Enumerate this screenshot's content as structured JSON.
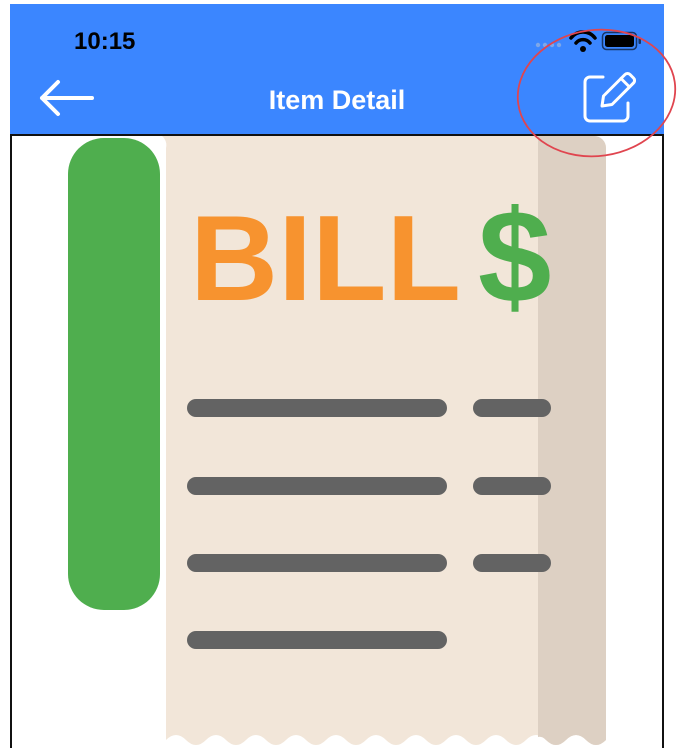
{
  "status_bar": {
    "time": "10:15",
    "icons": [
      "cellular-dots-icon",
      "wifi-icon",
      "battery-icon"
    ]
  },
  "header": {
    "title": "Item Detail",
    "back_icon": "arrow-left-icon",
    "edit_icon": "edit-pencil-icon",
    "background_color": "#3B86FF"
  },
  "annotation": {
    "shape": "ellipse",
    "target": "edit-button",
    "color": "#E0454F"
  },
  "illustration": {
    "main_text": "BILL",
    "symbol": "$",
    "colors": {
      "paper": "#F2E6D9",
      "paper_shadow": "#DDD0C3",
      "spine": "#4FAE4E",
      "bill_text": "#F7932F",
      "dollar": "#4FAE4E",
      "lines": "#636363"
    }
  }
}
